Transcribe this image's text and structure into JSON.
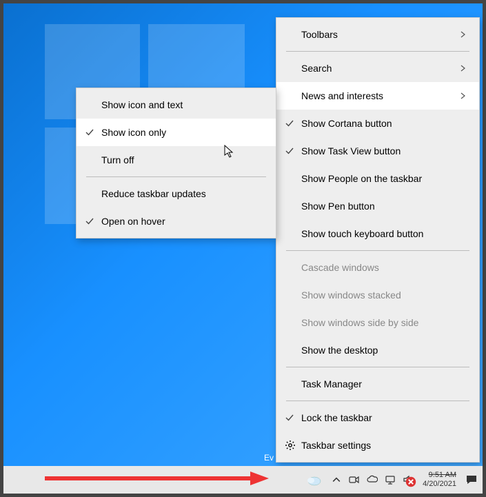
{
  "main_menu": {
    "toolbars": "Toolbars",
    "search": "Search",
    "news": "News and interests",
    "cortana": "Show Cortana button",
    "taskview": "Show Task View button",
    "people": "Show People on the taskbar",
    "pen": "Show Pen button",
    "touchkb": "Show touch keyboard button",
    "cascade": "Cascade windows",
    "stacked": "Show windows stacked",
    "sidebyside": "Show windows side by side",
    "desktop": "Show the desktop",
    "taskmgr": "Task Manager",
    "lock": "Lock the taskbar",
    "settings": "Taskbar settings"
  },
  "sub_menu": {
    "icon_text": "Show icon and text",
    "icon_only": "Show icon only",
    "off": "Turn off",
    "reduce": "Reduce taskbar updates",
    "hover": "Open on hover"
  },
  "taskbar": {
    "time": "9:51 AM",
    "date": "4/20/2021",
    "ev": "Ev"
  }
}
